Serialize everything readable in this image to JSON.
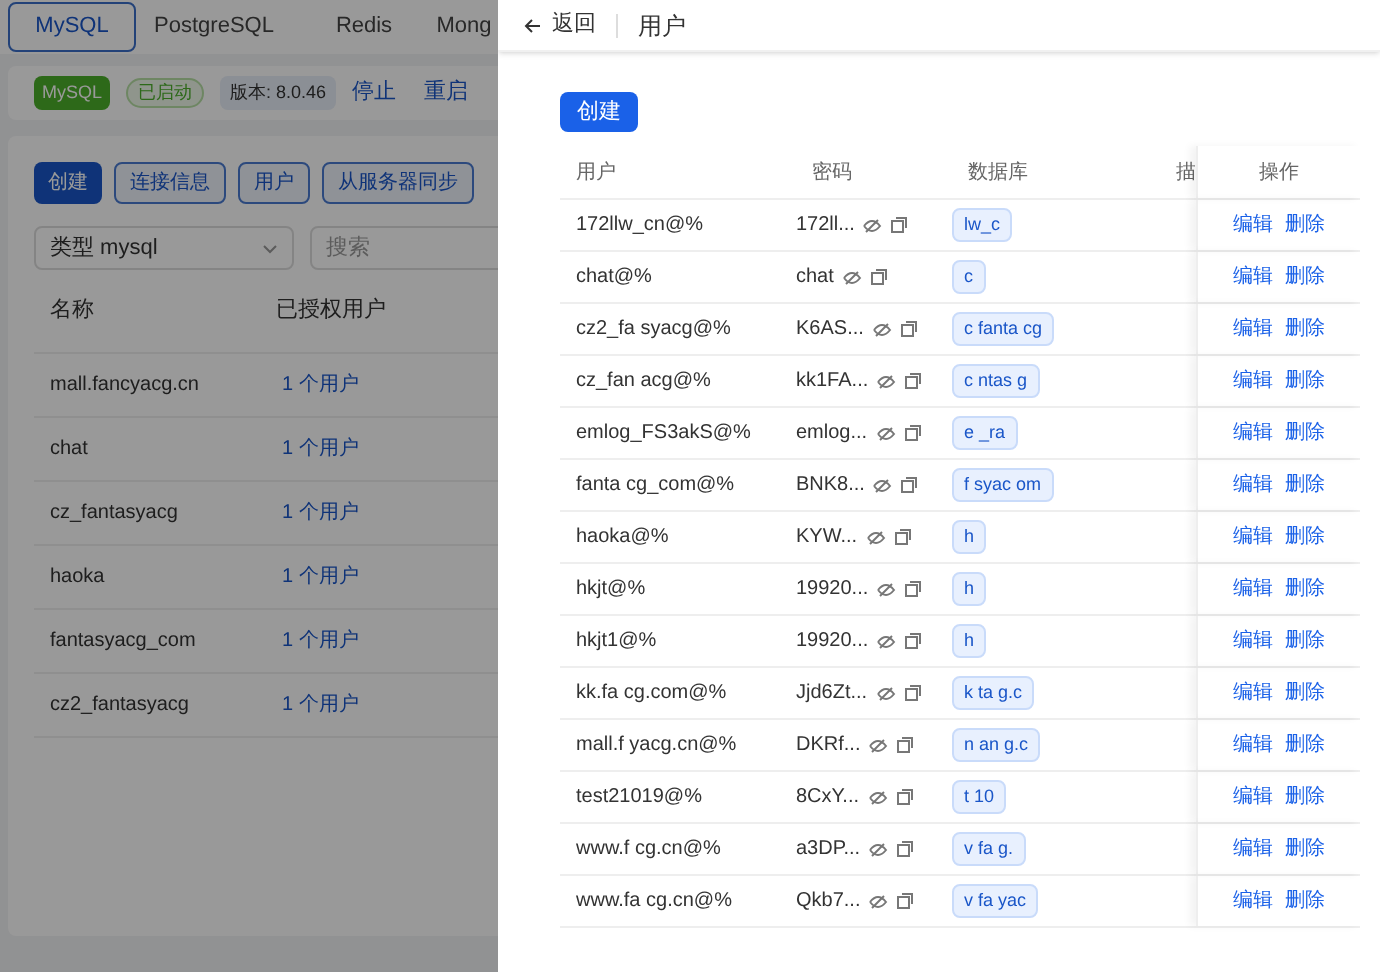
{
  "background": {
    "tabs": [
      {
        "label": "MySQL",
        "selected": true
      },
      {
        "label": "PostgreSQL",
        "selected": false
      },
      {
        "label": "Redis",
        "selected": false
      },
      {
        "label": "Mong",
        "selected": false
      }
    ],
    "status": {
      "service": "MySQL",
      "state": "已启动",
      "version": "版本: 8.0.46",
      "actions": [
        "停止",
        "重启"
      ]
    },
    "buttons": [
      {
        "label": "创建",
        "primary": true
      },
      {
        "label": "连接信息",
        "primary": false
      },
      {
        "label": "用户",
        "primary": false
      },
      {
        "label": "从服务器同步",
        "primary": false
      }
    ],
    "type_filter": "类型 mysql",
    "search": {
      "placeholder": "搜索"
    },
    "columns": [
      "名称",
      "已授权用户"
    ],
    "rows": [
      {
        "name": "mall.fancyacg.cn",
        "users": "1 个用户"
      },
      {
        "name": "chat",
        "users": "1 个用户"
      },
      {
        "name": "cz_fantasyacg",
        "users": "1 个用户"
      },
      {
        "name": "haoka",
        "users": "1 个用户"
      },
      {
        "name": "fantasyacg_com",
        "users": "1 个用户"
      },
      {
        "name": "cz2_fantasyacg",
        "users": "1 个用户"
      }
    ]
  },
  "drawer": {
    "back": "返回",
    "title": "用户",
    "create": "创建",
    "columns": [
      "用户",
      "密码",
      "数据库",
      "描",
      "操作"
    ],
    "rows": [
      {
        "user": "172llw_cn@%",
        "password": "172ll...",
        "db": "lw_c"
      },
      {
        "user": "chat@%",
        "password": "chat",
        "db": "c"
      },
      {
        "user": "cz2_fa syacg@%",
        "password": "K6AS...",
        "db": "c fanta cg"
      },
      {
        "user": "cz_fan acg@%",
        "password": "kk1FA...",
        "db": "c ntas g"
      },
      {
        "user": "emlog_FS3akS@%",
        "password": "emlog...",
        "db": "e _ra"
      },
      {
        "user": "fanta cg_com@%",
        "password": "BNK8...",
        "db": "f syac om"
      },
      {
        "user": "haoka@%",
        "password": "KYW...",
        "db": "h"
      },
      {
        "user": "hkjt@%",
        "password": "19920...",
        "db": "h"
      },
      {
        "user": "hkjt1@%",
        "password": "19920...",
        "db": "h"
      },
      {
        "user": "kk.fa cg.com@%",
        "password": "Jjd6Zt...",
        "db": "k ta g.c"
      },
      {
        "user": "mall.f yacg.cn@%",
        "password": "DKRf...",
        "db": "n an g.c"
      },
      {
        "user": "test21019@%",
        "password": "8CxY...",
        "db": "t 10"
      },
      {
        "user": "www.f cg.cn@%",
        "password": "a3DP...",
        "db": "v fa g."
      },
      {
        "user": "www.fa cg.cn@%",
        "password": "Qkb7...",
        "db": "v fa yac"
      }
    ],
    "row_actions": [
      [
        "编辑",
        "删除"
      ],
      [
        "编辑",
        "删除"
      ],
      [
        "编辑",
        "删除"
      ],
      [
        "编辑",
        "删除"
      ],
      [
        "编辑",
        "删除"
      ],
      [
        "编辑",
        "删除"
      ],
      [
        "编辑",
        "删除"
      ],
      [
        "编辑",
        "删除"
      ],
      [
        "编辑",
        "删除"
      ],
      [
        "编辑",
        "删除"
      ],
      [
        "编辑",
        "删除"
      ],
      [
        "编辑",
        "删除"
      ],
      [
        "编辑",
        "删除"
      ],
      [
        "编辑",
        "删除"
      ]
    ]
  }
}
